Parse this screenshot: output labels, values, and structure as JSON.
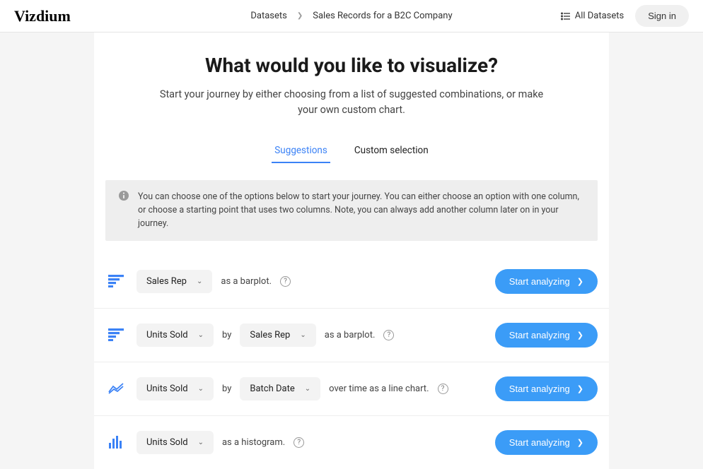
{
  "header": {
    "logo": "Vizdium",
    "breadcrumb": {
      "root": "Datasets",
      "current": "Sales Records for a B2C Company"
    },
    "all_datasets": "All Datasets",
    "signin": "Sign in"
  },
  "main": {
    "headline": "What would you like to visualize?",
    "subhead": "Start your journey by either choosing from a list of suggested combinations, or make your own custom chart.",
    "tabs": {
      "suggestions": "Suggestions",
      "custom": "Custom selection"
    },
    "info": "You can choose one of the options below to start your journey. You can either choose an option with one column, or choose a starting point that uses two columns. Note, you can always add another column later on in your journey."
  },
  "rows": [
    {
      "col1": "Sales Rep",
      "desc": "as a barplot."
    },
    {
      "col1": "Units Sold",
      "joiner": "by",
      "col2": "Sales Rep",
      "desc": "as a barplot."
    },
    {
      "col1": "Units Sold",
      "joiner": "by",
      "col2": "Batch Date",
      "desc": "over time as a line chart."
    },
    {
      "col1": "Units Sold",
      "desc": "as a histogram."
    }
  ],
  "buttons": {
    "start": "Start analyzing"
  }
}
